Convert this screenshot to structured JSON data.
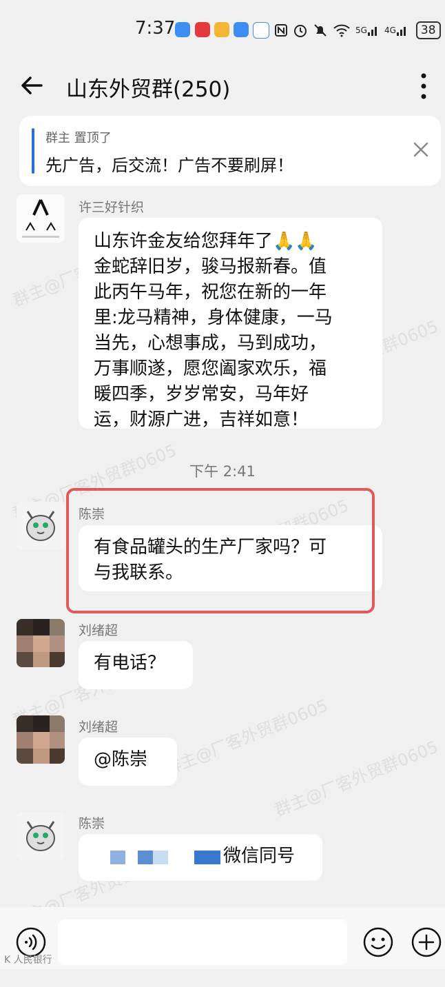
{
  "status_bar": {
    "time": "7:37",
    "wifi_label": "6",
    "signal1_label": "5G",
    "signal2_label": "4G",
    "battery": "38"
  },
  "header": {
    "title": "山东外贸群(250)",
    "back_icon": "arrow-left-icon",
    "more_icon": "more-vertical-icon"
  },
  "pinned": {
    "meta": "群主 置顶了",
    "text": "先广告，后交流！广告不要刷屏！"
  },
  "messages": [
    {
      "sender": "许三好针织",
      "text": "山东许金友给您拜年了🙏🙏\n金蛇辞旧岁，骏马报新春。值\n此丙午马年，祝您在新的一年\n里:龙马精神，身体健康，一马\n当先，心想事成，马到成功，\n万事顺遂，愿您阖家欢乐，福\n暖四季，岁岁常安，马年好\n运，财源广进，吉祥如意！"
    },
    {
      "sender": "陈崇",
      "text": "有食品罐头的生产厂家吗？可\n与我联系。"
    },
    {
      "sender": "刘绪超",
      "text": "有电话？"
    },
    {
      "sender": "刘绪超",
      "text": "@陈崇"
    },
    {
      "sender": "陈崇",
      "text": "微信同号"
    }
  ],
  "time_divider": "下午 2:41",
  "watermark": "群主@厂客外贸群0605",
  "corner_mark": "K 人民银行"
}
